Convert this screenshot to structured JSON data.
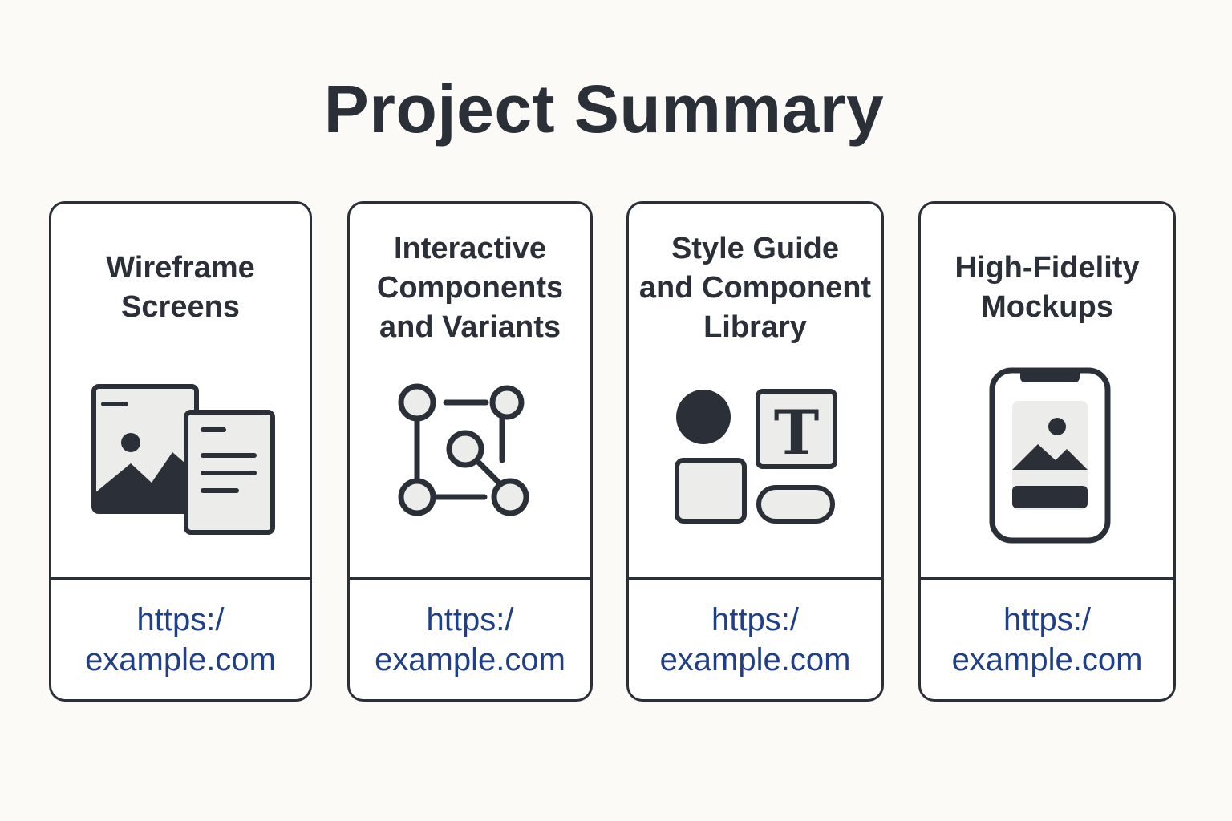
{
  "page": {
    "title": "Project Summary"
  },
  "colors": {
    "background": "#fcfaf6",
    "ink": "#2b3038",
    "light_fill": "#ececea",
    "link": "#1f3f86"
  },
  "cards": [
    {
      "title_lines": [
        "Wireframe",
        "Screens"
      ],
      "icon": "wireframe-screens-icon",
      "link_lines": [
        "https:/",
        "example.com"
      ]
    },
    {
      "title_lines": [
        "Interactive",
        "Components",
        "and Variants"
      ],
      "icon": "interactive-components-icon",
      "link_lines": [
        "https:/",
        "example.com"
      ]
    },
    {
      "title_lines": [
        "Style Guide",
        "and Component",
        "Library"
      ],
      "icon": "style-guide-icon",
      "link_lines": [
        "https:/",
        "example.com"
      ]
    },
    {
      "title_lines": [
        "High-Fidelity",
        "Mockups"
      ],
      "icon": "mobile-mockup-icon",
      "link_lines": [
        "https:/",
        "example.com"
      ]
    }
  ]
}
